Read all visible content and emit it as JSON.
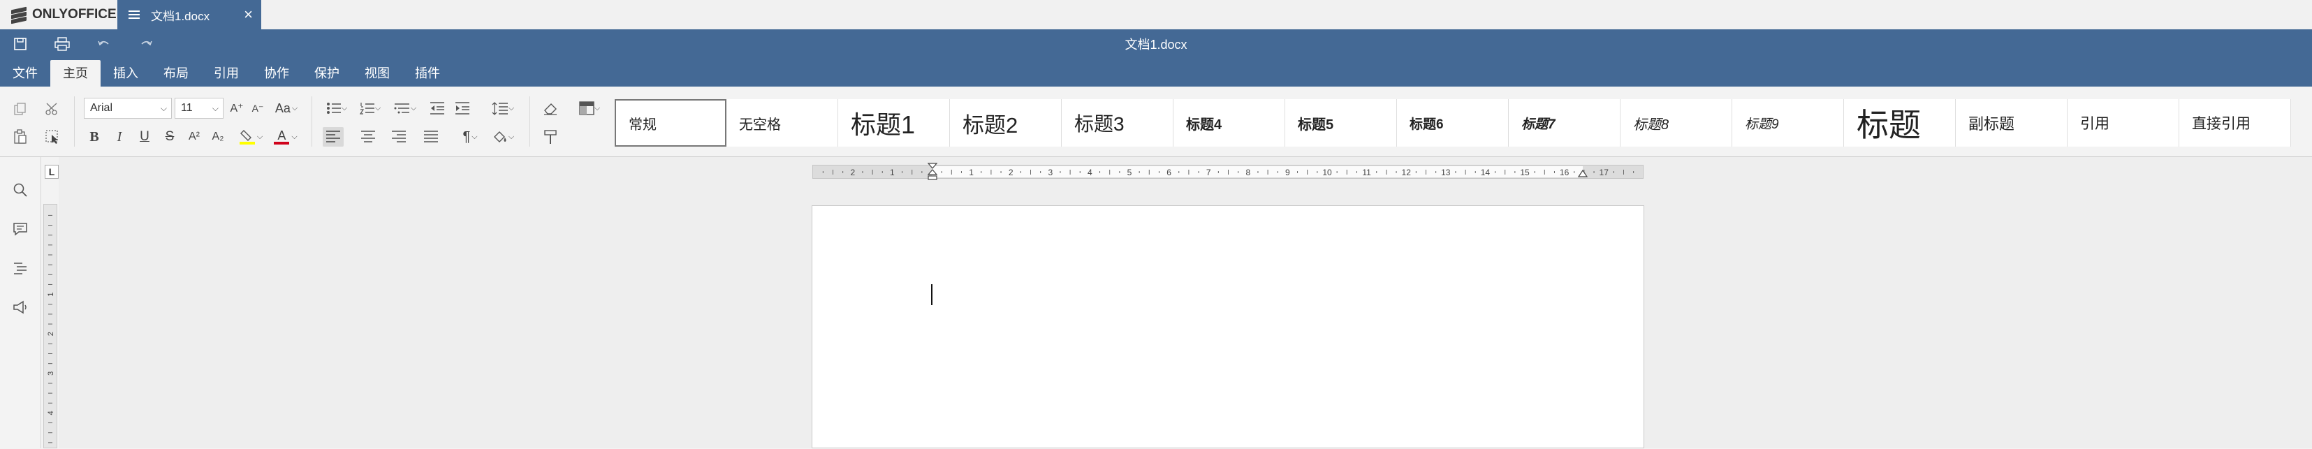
{
  "app": {
    "brand": "ONLYOFFICE"
  },
  "tab": {
    "title": "文档1.docx",
    "close": "×"
  },
  "window": {
    "title": "文档1.docx"
  },
  "menu": [
    "文件",
    "主页",
    "插入",
    "布局",
    "引用",
    "协作",
    "保护",
    "视图",
    "插件"
  ],
  "menu_active_index": 1,
  "font": {
    "name": "Arial",
    "size": "11"
  },
  "format_labels": {
    "bold": "B",
    "italic": "I",
    "underline": "U",
    "strike": "S",
    "superscript": "A²",
    "subscript": "A₂",
    "grow": "A⁺",
    "shrink": "A⁻",
    "case": "Aa",
    "font_color": "A",
    "pilcrow": "¶"
  },
  "styles": [
    "常规",
    "无空格",
    "标题1",
    "标题2",
    "标题3",
    "标题4",
    "标题5",
    "标题6",
    "标题7",
    "标题8",
    "标题9",
    "标题",
    "副标题",
    "引用",
    "直接引用"
  ],
  "selected_style_index": 0,
  "ruler": {
    "corner_label": "L",
    "horizontal_numbers": [
      "2",
      "1",
      "1",
      "2",
      "3",
      "4",
      "5",
      "6",
      "7",
      "8",
      "9",
      "10",
      "11",
      "12",
      "13",
      "14",
      "15",
      "16",
      "17"
    ],
    "vertical_numbers": [
      "1",
      "2",
      "3",
      "4"
    ]
  },
  "colors": {
    "header_bg": "#446995",
    "highlight": "#ffff00",
    "font_color": "#d0021b"
  }
}
